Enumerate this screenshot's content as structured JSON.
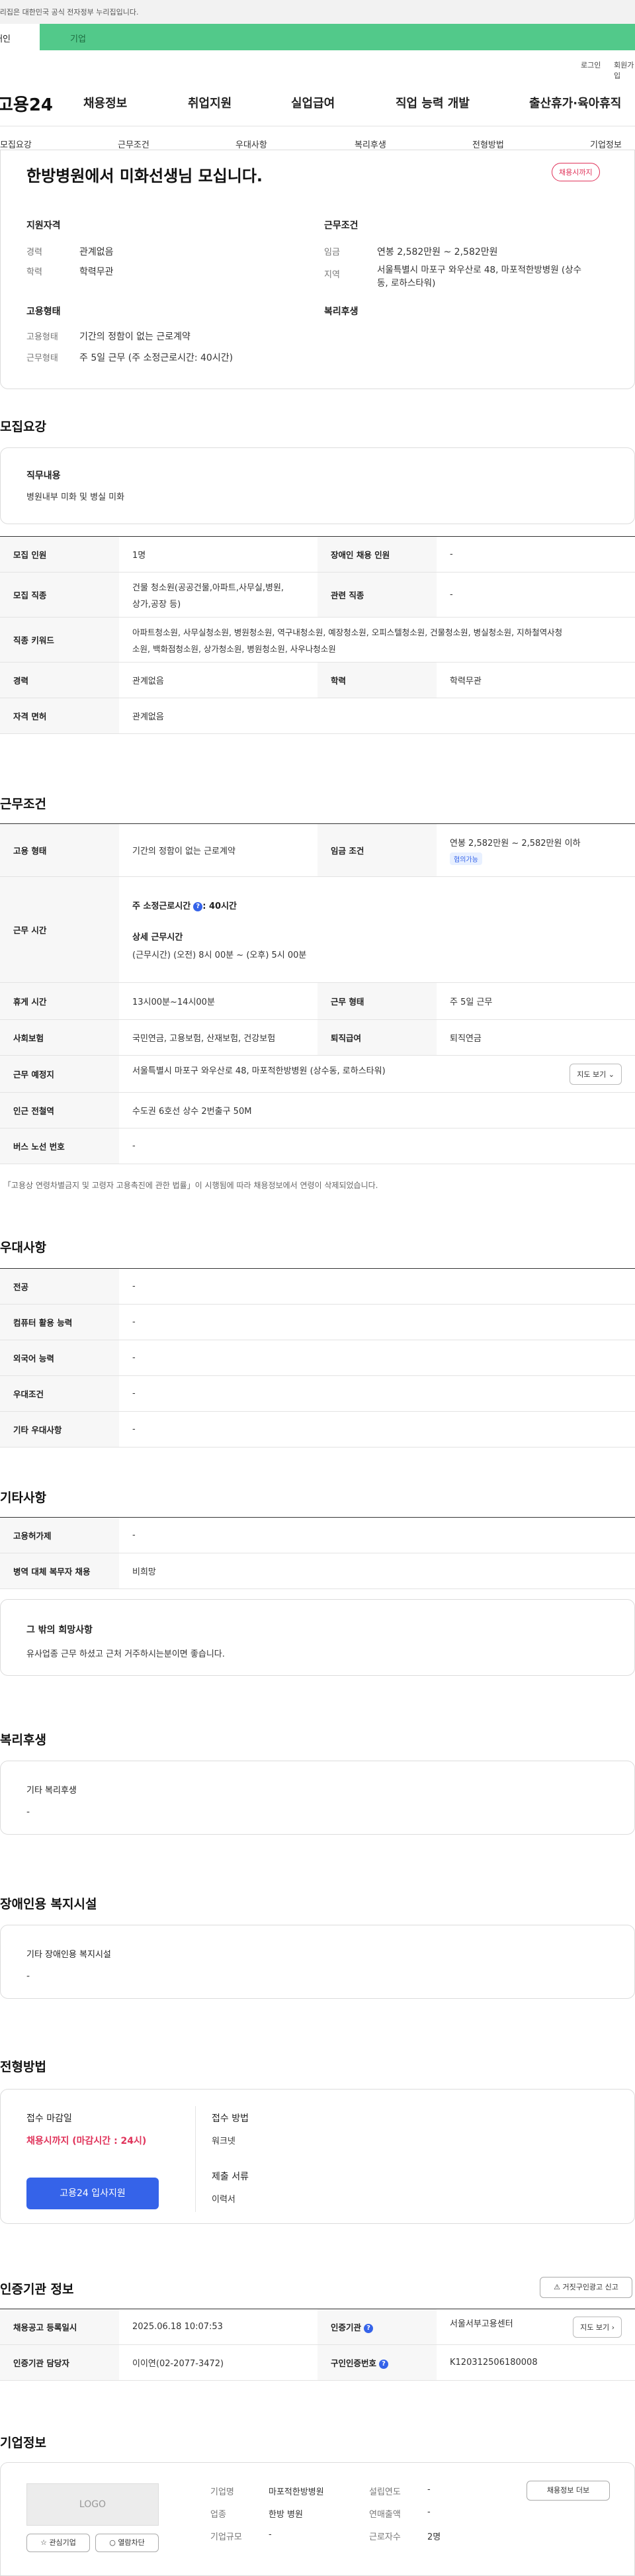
{
  "gov_notice": "이 누리집은 대한민국 공식 전자정부 누리집입니다.",
  "top_tabs": {
    "individual": "개인",
    "business": "기업"
  },
  "util": {
    "login": "로그인",
    "signup": "회원가입"
  },
  "logo": "고용24",
  "gnb": [
    "채용정보",
    "취업지원",
    "실업급여",
    "직업 능력 개발",
    "출산휴가·육아휴직"
  ],
  "sub_tabs": [
    "모집요강",
    "근무조건",
    "우대사항",
    "복리후생",
    "전형방법",
    "기업정보"
  ],
  "summary": {
    "title": "한방병원에서 미화선생님 모십니다.",
    "badge": "채용시까지",
    "qual_title": "지원자격",
    "career_label": "경력",
    "career_value": "관계없음",
    "edu_label": "학력",
    "edu_value": "학력무관",
    "work_title": "근무조건",
    "wage_label": "임금",
    "wage_value": "연봉 2,582만원 ~ 2,582만원",
    "area_label": "지역",
    "area_value_1": "서울특별시 마포구 와우산로 48, 마포적한방병원 (상수",
    "area_value_2": "동, 로하스타워)",
    "emp_title": "고용형태",
    "type_label": "고용형태",
    "type_value": "기간의 정함이 없는 근로계약",
    "hours_label": "근무형태",
    "hours_value": "주 5일 근무 (주 소정근로시간: 40시간)",
    "benefit_title": "복리후생"
  },
  "recruit": {
    "title": "모집요강",
    "duty_title": "직무내용",
    "duty_value": "병원내부 미화 및 병실 미화",
    "rows": {
      "count_label": "모집 인원",
      "count_value": "1명",
      "disabled_label": "장애인 채용 인원",
      "disabled_value": "-",
      "job_label": "모집 직종",
      "job_value_1": "건물 청소원(공공건물,아파트,사무실,병원,",
      "job_value_2": "상가,공장 등)",
      "related_label": "관련 직종",
      "related_value": "-",
      "kw_label": "직종 키워드",
      "kw_value_1": "아파트청소원, 사무실청소원, 병원청소원, 역구내청소원, 예장청소원, 오피스텔청소원, 건물청소원, 병실청소원, 지하철역사청",
      "kw_value_2": "소원, 백화점청소원, 상가청소원, 병원청소원, 사우나청소원",
      "career_label": "경력",
      "career_value": "관계없음",
      "edu_label": "학력",
      "edu_value": "학력무관",
      "license_label": "자격 면허",
      "license_value": "관계없음"
    }
  },
  "conditions": {
    "title": "근무조건",
    "type_label": "고용 형태",
    "type_value": "기간의 정함이 없는 근로계약",
    "wage_label": "임금 조건",
    "wage_value": "연봉 2,582만원 ~ 2,582만원 이하",
    "wage_chip": "협의가능",
    "time_label": "근무 시간",
    "weekly_label": "주 소정근로시간",
    "weekly_value": ": 40시간",
    "detail_label": "상세 근무시간",
    "detail_value": "(근무시간) (오전) 8시 00분 ~ (오후) 5시 00분",
    "break_label": "휴게 시간",
    "break_value": "13시00분~14시00분",
    "form_label": "근무 형태",
    "form_value": "주 5일 근무",
    "ins_label": "사회보험",
    "ins_value": "국민연금, 고용보험, 산재보험, 건강보험",
    "retire_label": "퇴직급여",
    "retire_value": "퇴직연금",
    "place_label": "근무 예정지",
    "place_value": "서울특별시 마포구 와우산로 48, 마포적한방병원 (상수동, 로하스타워)",
    "map_btn": "지도 보기",
    "subway_label": "인근 전철역",
    "subway_value": "수도권 6호선 상수 2번출구 50M",
    "bus_label": "버스 노선 번호",
    "bus_value": "-",
    "notice": "「고용상 연령차별금지 및 고령자 고용촉진에 관한 법률」이 시행됨에 따라 채용정보에서 연령이 삭제되었습니다."
  },
  "preference": {
    "title": "우대사항",
    "rows": [
      {
        "label": "전공",
        "value": "-"
      },
      {
        "label": "컴퓨터 활용 능력",
        "value": "-"
      },
      {
        "label": "외국어 능력",
        "value": "-"
      },
      {
        "label": "우대조건",
        "value": "-"
      },
      {
        "label": "기타 우대사항",
        "value": "-"
      }
    ]
  },
  "etc": {
    "title": "기타사항",
    "rows": [
      {
        "label": "고용허가제",
        "value": "-"
      },
      {
        "label": "병역 대체 복무자 채용",
        "value": "비희망"
      }
    ],
    "wish_title": "그 밖의 희망사항",
    "wish_value": "유사업종 근무 하셨고 근처 거주하시는분이면 좋습니다."
  },
  "welfare": {
    "title": "복리후생",
    "box_title": "기타 복리후생",
    "box_value": "-"
  },
  "disabled": {
    "title": "장애인용 복지시설",
    "box_title": "기타 장애인용 복지시설",
    "box_value": "-"
  },
  "selection": {
    "title": "전형방법",
    "deadline_label": "접수 마감일",
    "deadline_value": "채용시까지 (마감시간 : 24시)",
    "method_label": "접수 방법",
    "method_value": "워크넷",
    "docs_label": "제출 서류",
    "docs_value": "이력서",
    "apply_btn": "고용24 입사지원"
  },
  "agency": {
    "title": "인증기관 정보",
    "report_btn": "거짓구인광고 신고",
    "reg_label": "채용공고 등록일시",
    "reg_value": "2025.06.18 10:07:53",
    "org_label": "인증기관",
    "org_value": "서울서부고용센터",
    "map_btn": "지도 보기",
    "mgr_label": "인증기관 담당자",
    "mgr_value": "이이연(02-2077-3472)",
    "no_label": "구인인증번호",
    "no_value": "K120312506180008"
  },
  "company": {
    "title": "기업정보",
    "logo": "LOGO",
    "fav_btn": "관심기업",
    "block_btn": "열람차단",
    "name_label": "기업명",
    "name_value": "마포적한방병원",
    "year_label": "설립연도",
    "year_value": "-",
    "ind_label": "업종",
    "ind_value": "한방 병원",
    "sales_label": "연매출액",
    "sales_value": "-",
    "size_label": "기업규모",
    "size_value": "-",
    "emp_label": "근로자수",
    "emp_value": "2명",
    "more_btn": "채용정보 더보"
  }
}
